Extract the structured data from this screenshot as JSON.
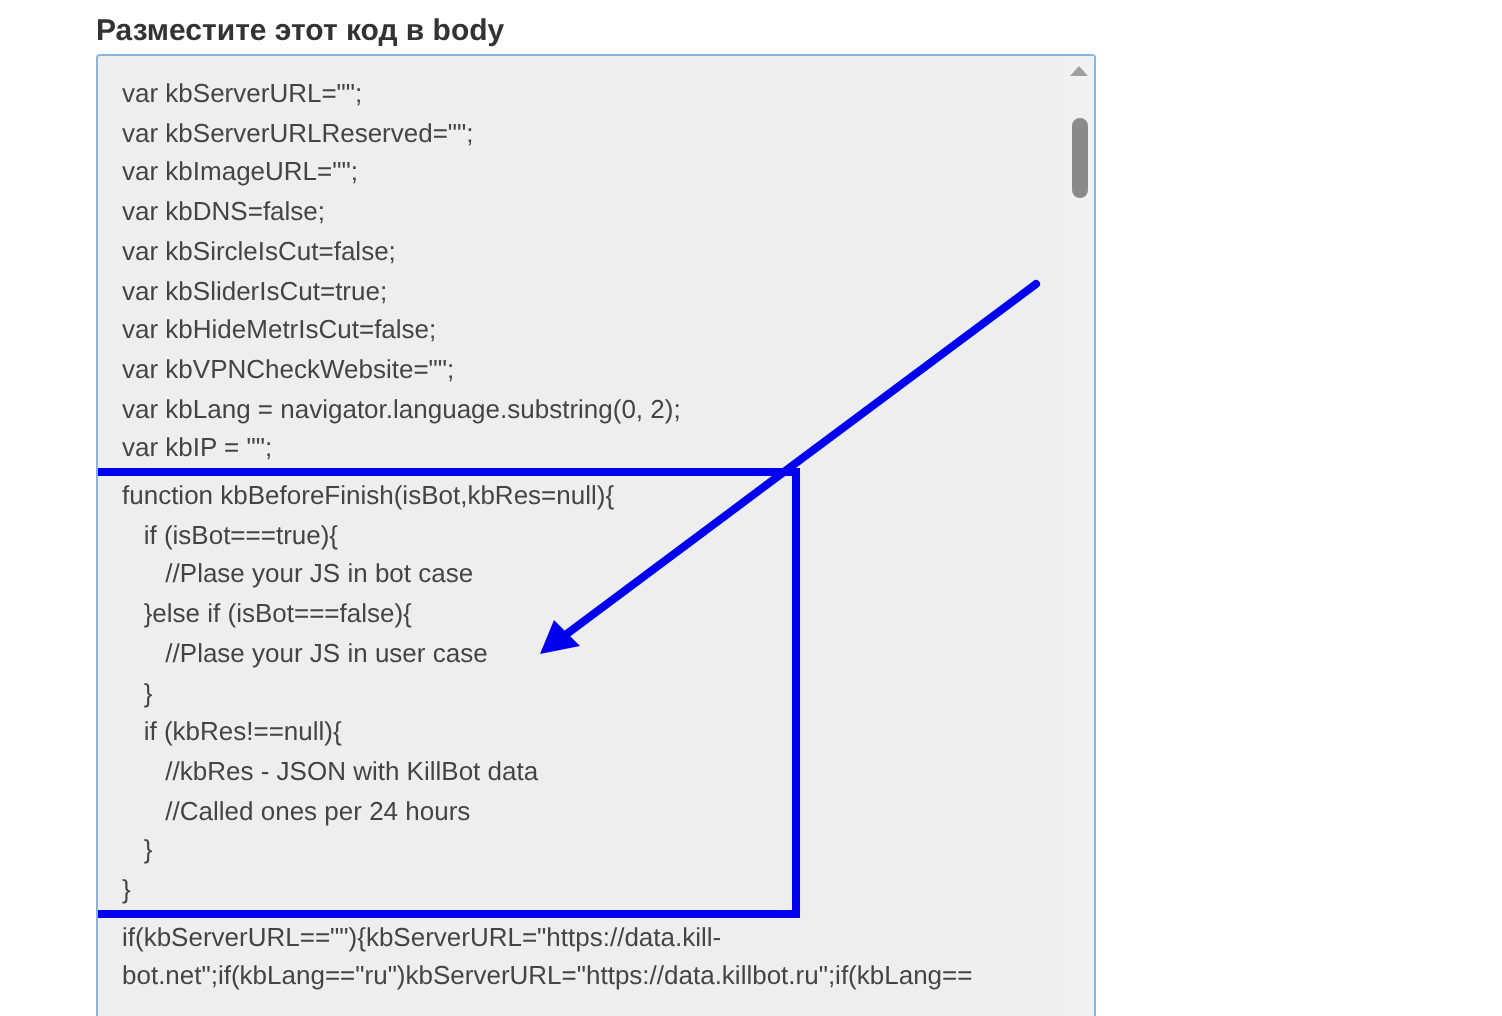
{
  "heading": "Разместите этот код в body",
  "code": {
    "lines_before": [
      "var kbServerURL=\"\";",
      "var kbServerURLReserved=\"\";",
      "var kbImageURL=\"\";",
      "var kbDNS=false;",
      "var kbSircleIsCut=false;",
      "var kbSliderIsCut=true;",
      "var kbHideMetrIsCut=false;",
      "var kbVPNCheckWebsite=\"\";",
      "var kbLang = navigator.language.substring(0, 2);",
      "var kbIP = \"\";"
    ],
    "highlighted_lines": [
      "function kbBeforeFinish(isBot,kbRes=null){",
      "   if (isBot===true){",
      "      //Plase your JS in bot case",
      "   }else if (isBot===false){",
      "      //Plase your JS in user case",
      "   }",
      "   if (kbRes!==null){",
      "      //kbRes - JSON with KillBot data",
      "      //Called ones per 24 hours",
      "   }",
      "}"
    ],
    "lines_after": [
      "if(kbServerURL==\"\"){kbServerURL=\"https://data.kill-",
      "bot.net\";if(kbLang==\"ru\")kbServerURL=\"https://data.killbot.ru\";if(kbLang=="
    ]
  }
}
